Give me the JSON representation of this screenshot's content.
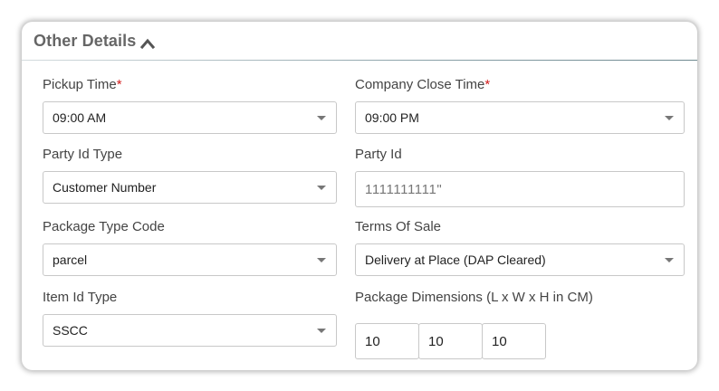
{
  "section": {
    "title": "Other Details",
    "collapse_icon": "chevron-up-icon"
  },
  "colors": {
    "required_marker": "#d21c1c",
    "title_text": "#666666",
    "label_text": "#444444",
    "field_border": "#c8c8c8"
  },
  "fields": {
    "pickup_time": {
      "label": "Pickup Time",
      "required_marker": "*",
      "value": "09:00 AM"
    },
    "company_close_time": {
      "label": "Company Close Time",
      "required_marker": "*",
      "value": "09:00 PM"
    },
    "party_id_type": {
      "label": "Party Id Type",
      "value": "Customer Number"
    },
    "party_id": {
      "label": "Party Id",
      "value": "1111111111\""
    },
    "package_type_code": {
      "label": "Package Type Code",
      "value": "parcel"
    },
    "terms_of_sale": {
      "label": "Terms Of Sale",
      "value": "Delivery at Place (DAP Cleared)"
    },
    "item_id_type": {
      "label": "Item Id Type",
      "value": "SSCC"
    },
    "package_dimensions": {
      "label": "Package Dimensions (L x W x H in CM)",
      "length": "10",
      "width": "10",
      "height": "10"
    }
  }
}
